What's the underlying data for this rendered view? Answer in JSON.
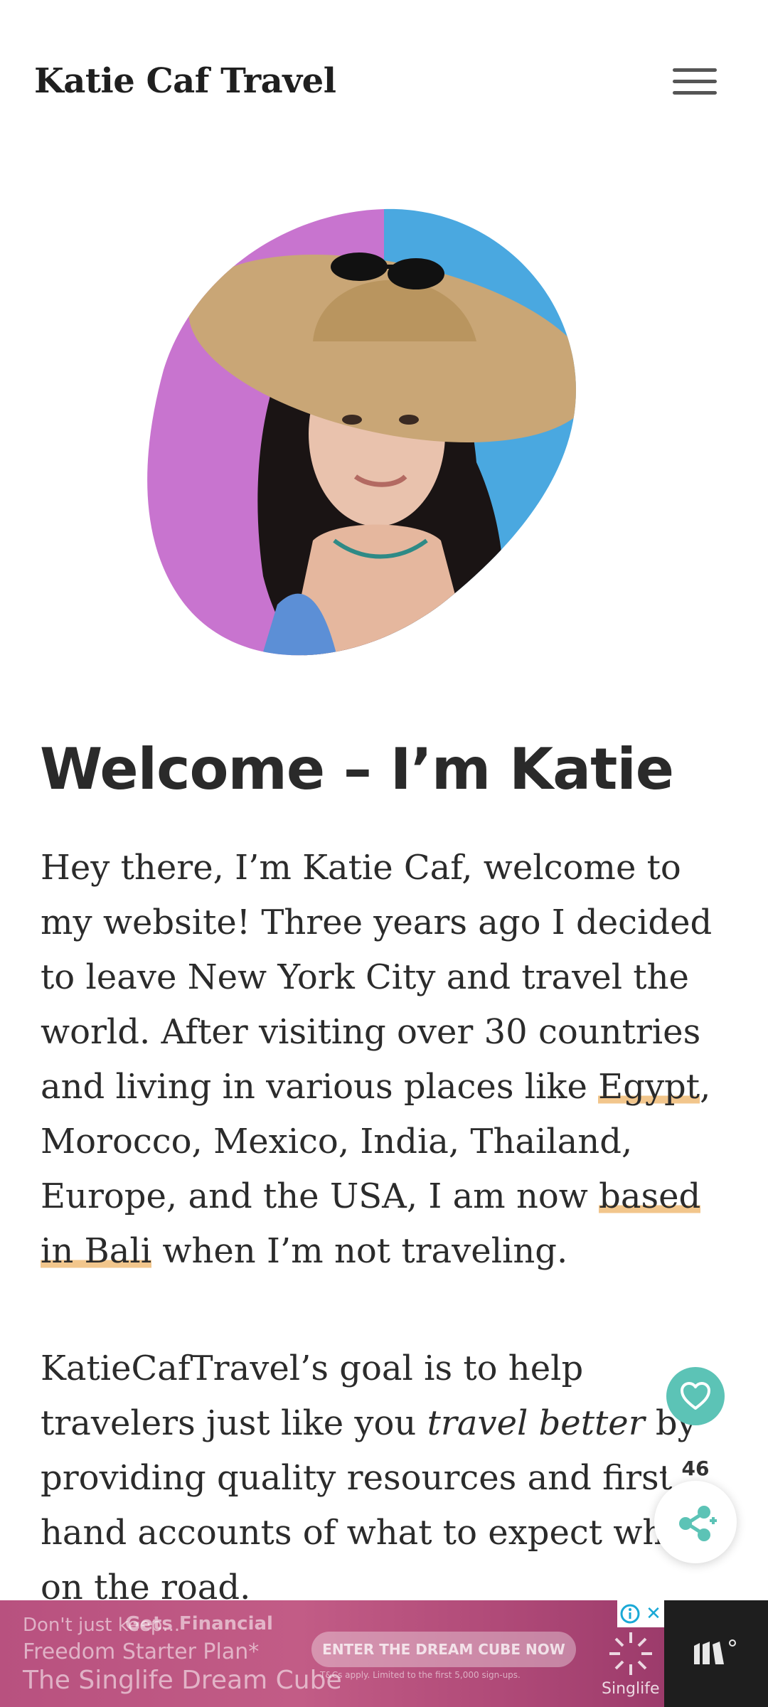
{
  "header": {
    "site_title": "Katie Caf Travel",
    "menu_icon": "hamburger-menu-icon"
  },
  "hero": {
    "image_icon": "profile-photo"
  },
  "main": {
    "heading": "Welcome – I’m Katie",
    "paragraph1": {
      "t1": "Hey there, I’m Katie Caf, welcome to my website! Three years ago I decided to leave New York City and travel the world. After visiting over 30 countries and living in various places like ",
      "link_egypt": "Egypt",
      "t2": ", Morocco, Mexico, India, Thailand, Europe, and the USA, I am now ",
      "link_bali": "based in Bali",
      "t3": " when I’m not traveling."
    },
    "paragraph2": {
      "t1": "KatieCafTravel’s goal is to help travelers just like you ",
      "em": "travel better",
      "t2": " by providing quality resources and first-hand accounts of what to expect while on the road."
    }
  },
  "floating": {
    "favorite_icon": "heart-icon",
    "count": "46",
    "share_icon": "share-icon"
  },
  "ad": {
    "line1": "Don't just keep...",
    "line2": "Freedom Starter Plan*",
    "line3": "The Singlife Dream Cube",
    "headline": "Gets Financial",
    "cta": "ENTER THE DREAM CUBE NOW",
    "fine_print": "T&Cs apply. Limited to the first 5,000 sign-ups.",
    "brand": "Singlife",
    "info_icon": "info-icon",
    "close_label": "✕",
    "side_logo_icon": "mediavine-logo-icon"
  },
  "colors": {
    "accent": "#5cc3b6",
    "link_highlight": "#f2c68c",
    "ad_background": "#b8517f",
    "ad_side": "#1e1e1e"
  }
}
